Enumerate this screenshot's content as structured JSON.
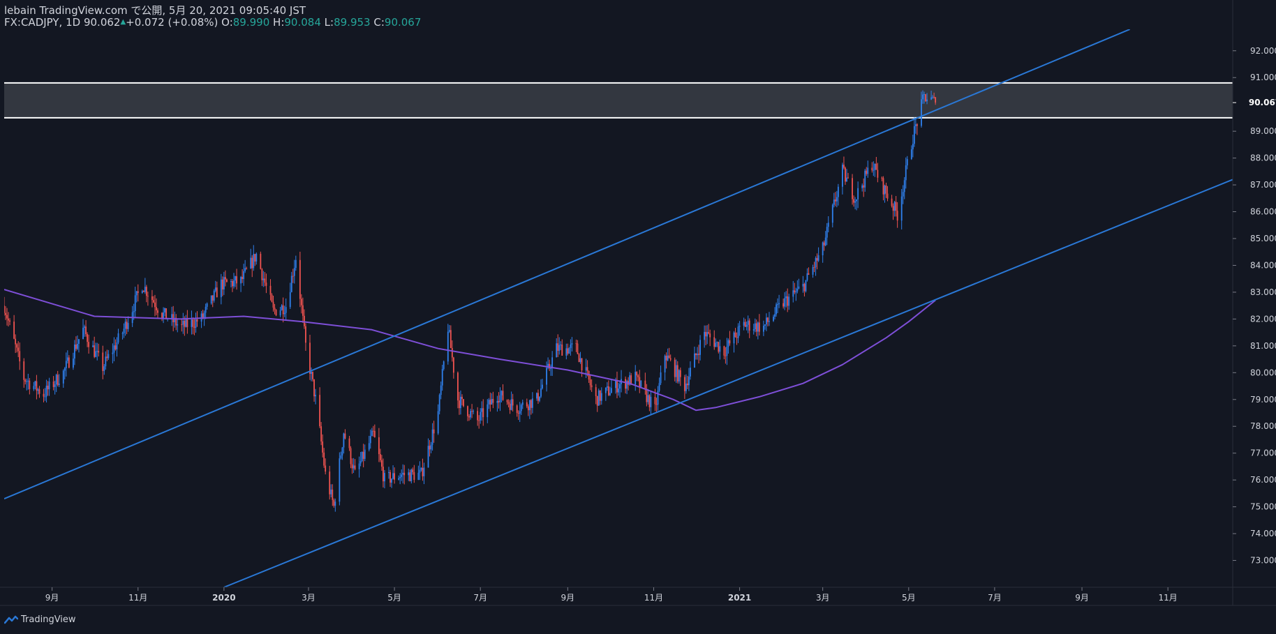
{
  "header": {
    "published": "lebain TradingView.com で公開, 5月 20, 2021 09:05:40 JST",
    "symbol": "FX:CADJPY, 1D",
    "last": "90.062",
    "arrow": "▲",
    "change": "+0.072 (+0.08%)",
    "o_label": "O:",
    "o_value": "89.990",
    "h_label": "H:",
    "h_value": "90.084",
    "l_label": "L:",
    "l_value": "89.953",
    "c_label": "C:",
    "c_value": "90.067"
  },
  "footer": {
    "brand": "TradingView",
    "logo_icon": "tradingview-logo-icon"
  },
  "colors": {
    "background": "#131722",
    "up": "#2f80ed",
    "down": "#ef5350",
    "ma": "#7e4fd8",
    "trend": "#2a78d6",
    "zone": "#3a3d45",
    "zone_border": "#ffffff",
    "text": "#d1d4dc",
    "accent": "#26a69a"
  },
  "chart_data": {
    "type": "candlestick",
    "symbol": "FX:CADJPY",
    "interval": "1D",
    "x_range": [
      "2019-07-29",
      "2021-12-17"
    ],
    "y_range": [
      72.0,
      92.8
    ],
    "y_ticks": [
      "92.000",
      "91.000",
      "89.000",
      "88.000",
      "87.000",
      "86.000",
      "85.000",
      "84.000",
      "83.000",
      "82.000",
      "81.000",
      "80.000",
      "79.000",
      "78.000",
      "77.000",
      "76.000",
      "75.000",
      "74.000",
      "73.000"
    ],
    "last_price_label": "90.067",
    "last_price": 90.067,
    "x_ticks": [
      {
        "label": "9月",
        "date": "2019-09-01"
      },
      {
        "label": "11月",
        "date": "2019-11-01"
      },
      {
        "label": "2020",
        "date": "2020-01-01"
      },
      {
        "label": "3月",
        "date": "2020-03-01"
      },
      {
        "label": "5月",
        "date": "2020-05-01"
      },
      {
        "label": "7月",
        "date": "2020-07-01"
      },
      {
        "label": "9月",
        "date": "2020-09-01"
      },
      {
        "label": "11月",
        "date": "2020-11-01"
      },
      {
        "label": "2021",
        "date": "2021-01-01"
      },
      {
        "label": "3月",
        "date": "2021-03-01"
      },
      {
        "label": "5月",
        "date": "2021-05-01"
      },
      {
        "label": "7月",
        "date": "2021-07-01"
      },
      {
        "label": "9月",
        "date": "2021-09-01"
      },
      {
        "label": "11月",
        "date": "2021-11-01"
      }
    ],
    "price_path": [
      [
        "2019-07-29",
        82.5
      ],
      [
        "2019-08-12",
        79.8
      ],
      [
        "2019-08-26",
        79.2
      ],
      [
        "2019-09-09",
        80.0
      ],
      [
        "2019-09-23",
        81.6
      ],
      [
        "2019-10-07",
        80.2
      ],
      [
        "2019-10-21",
        81.5
      ],
      [
        "2019-11-04",
        83.3
      ],
      [
        "2019-11-18",
        82.2
      ],
      [
        "2019-12-02",
        81.7
      ],
      [
        "2019-12-16",
        82.0
      ],
      [
        "2019-12-30",
        83.3
      ],
      [
        "2020-01-13",
        83.4
      ],
      [
        "2020-01-24",
        84.4
      ],
      [
        "2020-02-05",
        82.3
      ],
      [
        "2020-02-14",
        82.5
      ],
      [
        "2020-02-21",
        84.3
      ],
      [
        "2020-02-28",
        81.0
      ],
      [
        "2020-03-06",
        79.0
      ],
      [
        "2020-03-13",
        76.2
      ],
      [
        "2020-03-19",
        75.0
      ],
      [
        "2020-03-26",
        77.8
      ],
      [
        "2020-04-03",
        76.2
      ],
      [
        "2020-04-16",
        77.7
      ],
      [
        "2020-04-24",
        76.0
      ],
      [
        "2020-05-06",
        76.2
      ],
      [
        "2020-05-20",
        76.2
      ],
      [
        "2020-06-01",
        78.5
      ],
      [
        "2020-06-08",
        81.7
      ],
      [
        "2020-06-15",
        79.0
      ],
      [
        "2020-06-29",
        78.2
      ],
      [
        "2020-07-13",
        79.2
      ],
      [
        "2020-07-27",
        78.7
      ],
      [
        "2020-08-10",
        79.0
      ],
      [
        "2020-08-24",
        80.9
      ],
      [
        "2020-09-07",
        80.9
      ],
      [
        "2020-09-21",
        79.0
      ],
      [
        "2020-10-05",
        79.5
      ],
      [
        "2020-10-19",
        79.8
      ],
      [
        "2020-11-02",
        78.6
      ],
      [
        "2020-11-09",
        80.7
      ],
      [
        "2020-11-23",
        79.5
      ],
      [
        "2020-12-07",
        81.5
      ],
      [
        "2020-12-21",
        80.8
      ],
      [
        "2021-01-04",
        81.8
      ],
      [
        "2021-01-18",
        81.7
      ],
      [
        "2021-02-01",
        82.6
      ],
      [
        "2021-02-15",
        83.2
      ],
      [
        "2021-03-01",
        84.6
      ],
      [
        "2021-03-15",
        87.5
      ],
      [
        "2021-03-24",
        86.5
      ],
      [
        "2021-04-05",
        87.8
      ],
      [
        "2021-04-14",
        86.8
      ],
      [
        "2021-04-23",
        85.9
      ],
      [
        "2021-05-04",
        88.8
      ],
      [
        "2021-05-12",
        90.3
      ],
      [
        "2021-05-20",
        90.067
      ]
    ],
    "moving_average": [
      [
        "2019-07-29",
        83.1
      ],
      [
        "2019-10-01",
        82.1
      ],
      [
        "2019-12-01",
        82.0
      ],
      [
        "2020-01-15",
        82.1
      ],
      [
        "2020-02-26",
        81.9
      ],
      [
        "2020-04-15",
        81.6
      ],
      [
        "2020-06-01",
        80.9
      ],
      [
        "2020-07-15",
        80.5
      ],
      [
        "2020-09-01",
        80.1
      ],
      [
        "2020-10-15",
        79.6
      ],
      [
        "2020-11-15",
        79.0
      ],
      [
        "2020-12-01",
        78.6
      ],
      [
        "2020-12-15",
        78.7
      ],
      [
        "2021-01-15",
        79.1
      ],
      [
        "2021-02-15",
        79.6
      ],
      [
        "2021-03-15",
        80.3
      ],
      [
        "2021-04-15",
        81.3
      ],
      [
        "2021-05-01",
        81.9
      ],
      [
        "2021-05-20",
        82.7
      ]
    ],
    "trendlines": [
      {
        "p1": [
          "2019-07-29",
          75.3
        ],
        "p2": [
          "2021-10-05",
          92.8
        ]
      },
      {
        "p1": [
          "2020-01-01",
          72.0
        ],
        "p2": [
          "2021-12-17",
          87.2
        ]
      }
    ],
    "zone": {
      "top": 90.8,
      "bottom": 89.5
    }
  }
}
